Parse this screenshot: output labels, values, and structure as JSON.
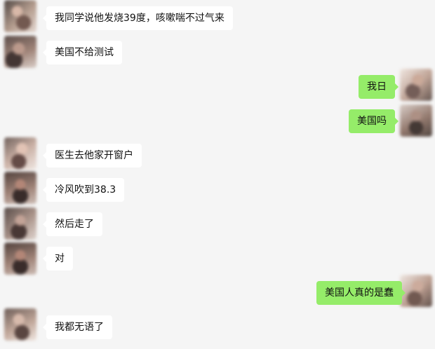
{
  "messages": [
    {
      "side": "left",
      "text": "我同学说他发烧39度，咳嗽喘不过气来"
    },
    {
      "side": "left",
      "text": "美国不给测试"
    },
    {
      "side": "right",
      "text": "我日"
    },
    {
      "side": "right",
      "text": "美国吗"
    },
    {
      "side": "left",
      "text": "医生去他家开窗户"
    },
    {
      "side": "left",
      "text": "冷风吹到38.3"
    },
    {
      "side": "left",
      "text": "然后走了"
    },
    {
      "side": "left",
      "text": "对"
    },
    {
      "side": "right",
      "text": "美国人真的是蠢"
    },
    {
      "side": "left",
      "text": "我都无语了"
    }
  ],
  "colors": {
    "background": "#f5f5f5",
    "incoming_bubble": "#ffffff",
    "outgoing_bubble": "#95ec69"
  }
}
